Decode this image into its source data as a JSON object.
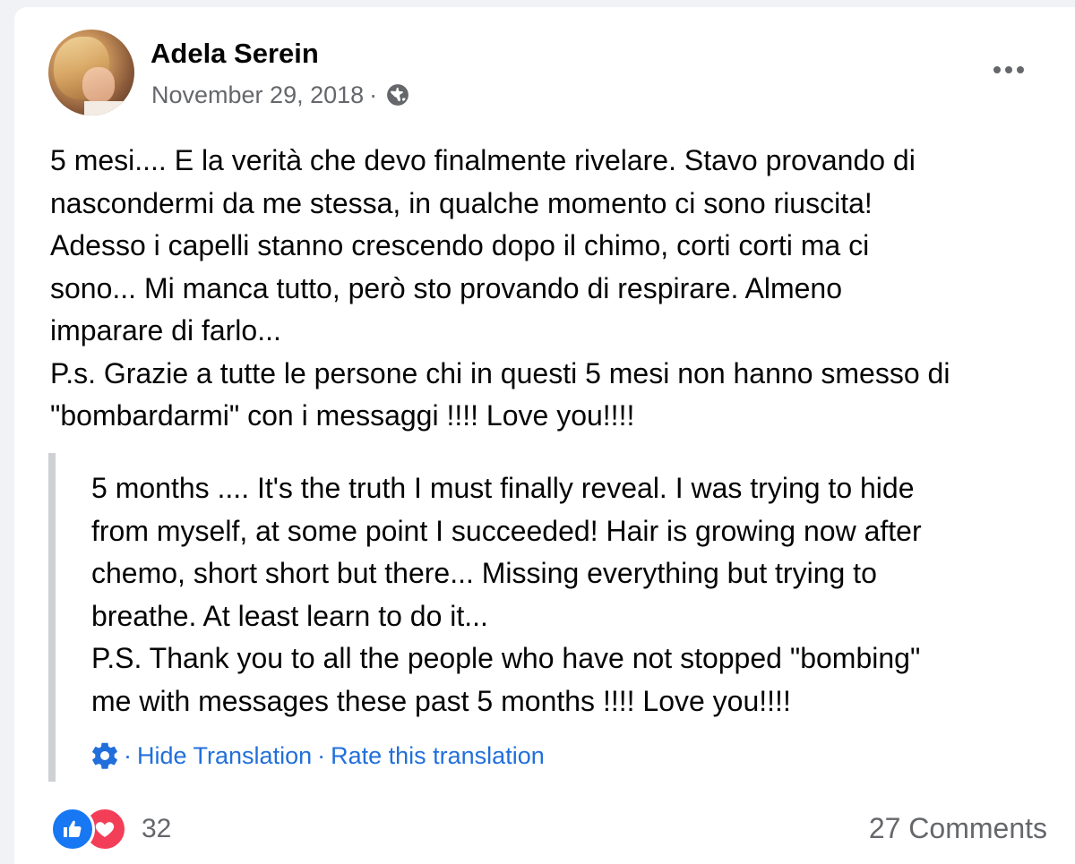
{
  "post": {
    "author": "Adela Serein",
    "date": "November 29, 2018",
    "separator": "·",
    "privacy_icon": "globe-icon",
    "more_icon": "more-options-icon",
    "text": "5 mesi.... E la verità che devo finalmente rivelare. Stavo provando di\nnascondermi da me stessa, in qualche momento ci sono riuscita!\nAdesso i capelli stanno crescendo dopo il chimo, corti corti ma ci\nsono... Mi manca tutto, però sto provando di respirare. Almeno\nimparare di farlo...\nP.s. Grazie a tutte le persone chi in questi 5 mesi non hanno smesso di\n\"bombardarmi\" con i messaggi !!!! Love you!!!!"
  },
  "translation": {
    "text": "5 months .... It's the truth I must finally reveal. I was trying to hide\nfrom myself, at some point I succeeded! Hair is growing now after\nchemo, short short but there... Missing everything but trying to\nbreathe. At least learn to do it...\nP.S. Thank you to all the people who have not stopped \"bombing\"\nme with messages these past 5 months !!!! Love you!!!!",
    "settings_icon": "gear-icon",
    "separator": "·",
    "hide_label": "Hide Translation",
    "rate_label": "Rate this translation"
  },
  "reactions": {
    "icons": [
      "like-icon",
      "love-icon"
    ],
    "count": "32"
  },
  "comments": {
    "label": "27 Comments"
  },
  "colors": {
    "link_blue": "#216fdb",
    "like_blue": "#1877f2",
    "love_red": "#f33e58",
    "secondary_text": "#65676b"
  }
}
